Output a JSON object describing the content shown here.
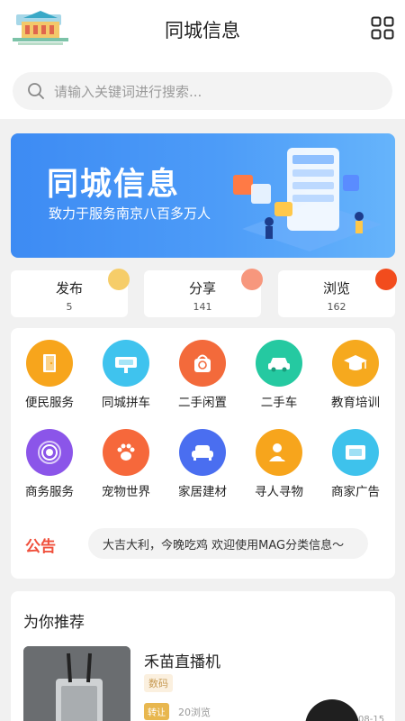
{
  "header": {
    "title": "同城信息",
    "search_placeholder": "请输入关键词进行搜索..."
  },
  "banner": {
    "title": "同城信息",
    "subtitle": "致力于服务南京八百多万人"
  },
  "stats": [
    {
      "label": "发布",
      "value": "5",
      "color": "#f6cd69"
    },
    {
      "label": "分享",
      "value": "141",
      "color": "#f7977d"
    },
    {
      "label": "浏览",
      "value": "162",
      "color": "#f24c1d"
    }
  ],
  "categories": [
    {
      "label": "便民服务",
      "icon": "door-icon",
      "color": "#f7a51c"
    },
    {
      "label": "同城拼车",
      "icon": "carpool-sign-icon",
      "color": "#3fc3ee"
    },
    {
      "label": "二手闲置",
      "icon": "bag-icon",
      "color": "#f36a3b"
    },
    {
      "label": "二手车",
      "icon": "car-icon",
      "color": "#25c9a1"
    },
    {
      "label": "教育培训",
      "icon": "graduation-cap-icon",
      "color": "#f6a91e"
    },
    {
      "label": "商务服务",
      "icon": "broadcast-icon",
      "color": "#8b55e9"
    },
    {
      "label": "宠物世界",
      "icon": "paw-icon",
      "color": "#f6683b"
    },
    {
      "label": "家居建材",
      "icon": "sofa-icon",
      "color": "#4a6ef0"
    },
    {
      "label": "寻人寻物",
      "icon": "person-search-icon",
      "color": "#f7a51c"
    },
    {
      "label": "商家广告",
      "icon": "ad-board-icon",
      "color": "#3ec2ec"
    }
  ],
  "notice": {
    "logo_text": "公告",
    "text": "大吉大利，今晚吃鸡 欢迎使用MAG分类信息～"
  },
  "recommend": {
    "section_title": "为你推荐",
    "item": {
      "title": "禾苗直播机",
      "tag": "数码",
      "badge": "转让",
      "views": "20浏览",
      "date": "08-15"
    }
  }
}
